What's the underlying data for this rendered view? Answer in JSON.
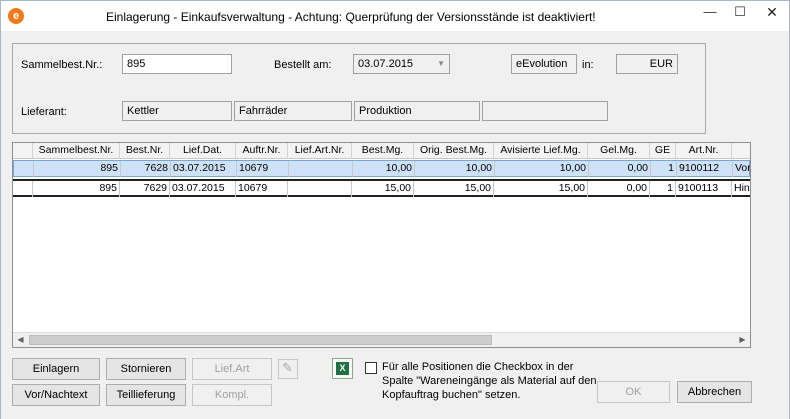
{
  "window": {
    "title": "Einlagerung - Einkaufsverwaltung - Achtung: Querprüfung der Versionsstände ist deaktiviert!",
    "app_icon_letter": "e",
    "minimize_glyph": "—",
    "maximize_glyph": "☐",
    "close_glyph": "✕"
  },
  "header": {
    "sammelbest_label": "Sammelbest.Nr.:",
    "sammelbest_value": "895",
    "bestellt_label": "Bestellt am:",
    "bestellt_value": "03.07.2015",
    "company_value": "eEvolution",
    "in_label": "in:",
    "currency_value": "EUR",
    "lieferant_label": "Lieferant:",
    "lieferant_value": "Kettler",
    "lieferant_fields": [
      "Fahrräder",
      "Produktion",
      ""
    ]
  },
  "grid": {
    "columns": [
      "Sammelbest.Nr.",
      "Best.Nr.",
      "Lief.Dat.",
      "Auftr.Nr.",
      "Lief.Art.Nr.",
      "Best.Mg.",
      "Orig. Best.Mg.",
      "Avisierte Lief.Mg.",
      "Gel.Mg.",
      "GE",
      "Art.Nr.",
      ""
    ],
    "rows": [
      {
        "sammelbest": "895",
        "best": "7628",
        "liefdat": "03.07.2015",
        "auftr": "10679",
        "liefart": "",
        "bestmg": "10,00",
        "origmg": "10,00",
        "avismg": "10,00",
        "gelmg": "0,00",
        "ge": "1",
        "artnr": "9100112",
        "extra": "Vor"
      },
      {
        "sammelbest": "895",
        "best": "7629",
        "liefdat": "03.07.2015",
        "auftr": "10679",
        "liefart": "",
        "bestmg": "15,00",
        "origmg": "15,00",
        "avismg": "15,00",
        "gelmg": "0,00",
        "ge": "1",
        "artnr": "9100113",
        "extra": "Hin"
      }
    ],
    "scroll_left_glyph": "◀",
    "scroll_right_glyph": "▶"
  },
  "buttons": {
    "einlagern": "Einlagern",
    "stornieren": "Stornieren",
    "lief_art": "Lief.Art",
    "vor_nachtext": "Vor/Nachtext",
    "teillieferung": "Teillieferung",
    "kompl": "Kompl.",
    "ok": "OK",
    "abbrechen": "Abbrechen"
  },
  "icons": {
    "pencil_glyph": "✎",
    "excel_glyph": "X"
  },
  "checkbox": {
    "checked": false,
    "label": "Für alle Positionen die Checkbox in der Spalte \"Wareneingänge als Material auf den Kopfauftrag buchen\" setzen."
  }
}
